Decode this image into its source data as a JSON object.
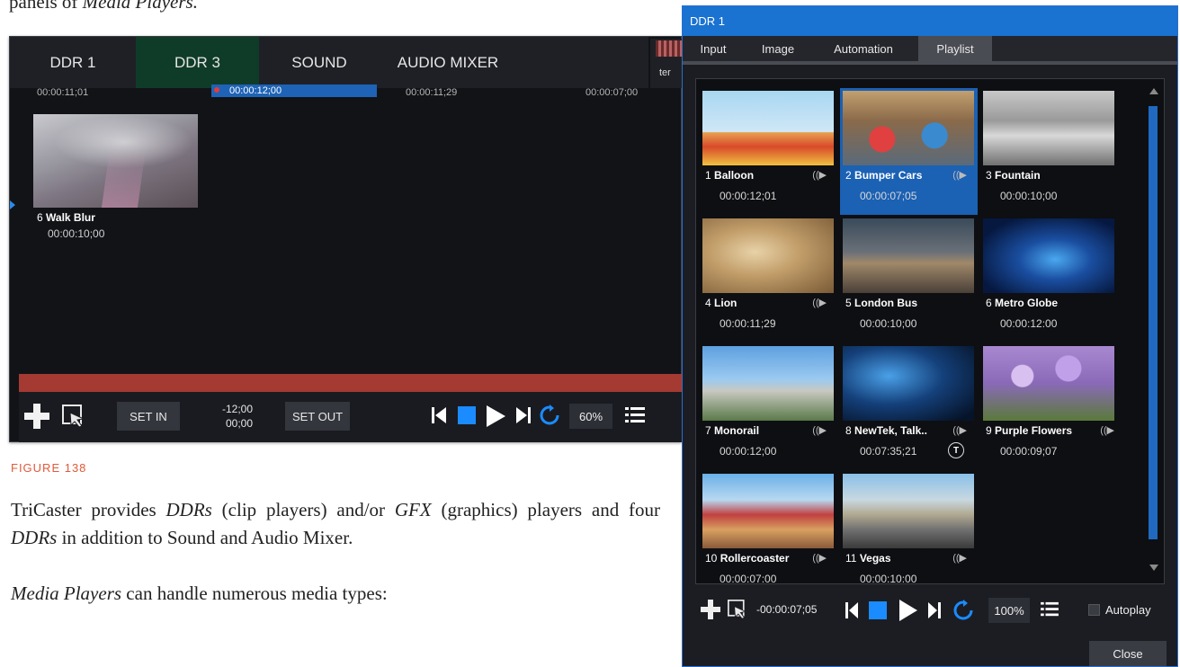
{
  "doc": {
    "top_text_prefix": "panels of ",
    "top_text_italic": "Media Players.",
    "figure_caption": "FIGURE 138",
    "para1_a": "TriCaster provides ",
    "para1_ddrs": "DDRs",
    "para1_b": " (clip players) and/or ",
    "para1_gfx": "GFX",
    "para1_c": " (graphics) players and four ",
    "para1_ddrs2": "DDRs",
    "para1_d": " in addition to Sound and Audio Mixer.",
    "para2_italic": "Media Players",
    "para2_rest": " can handle numerous media types:"
  },
  "left_panel": {
    "tabs": [
      "DDR 1",
      "DDR 3",
      "SOUND",
      "AUDIO MIXER"
    ],
    "corner_label": "ter",
    "times_row": [
      "00:00:11;01",
      "00:00:12;00",
      "00:00:11;29",
      "00:00:07;00"
    ],
    "clip": {
      "number": "6",
      "name": "Walk Blur",
      "duration": "00:00:10;00"
    },
    "controls": {
      "set_in": "SET IN",
      "set_out": "SET OUT",
      "dur_top": "-12;00",
      "dur_bottom": "00;00",
      "speed": "60%"
    }
  },
  "dialog": {
    "title": "DDR 1",
    "tabs": [
      "Input",
      "Image",
      "Automation",
      "Playlist"
    ],
    "active_tab": "Playlist",
    "items": [
      {
        "num": "1",
        "name": "Balloon",
        "time": "00:00:12;01",
        "audio": true
      },
      {
        "num": "2",
        "name": "Bumper Cars",
        "time": "00:00:07;05",
        "audio": true,
        "selected": true
      },
      {
        "num": "3",
        "name": "Fountain",
        "time": "00:00:10;00",
        "audio": false
      },
      {
        "num": "4",
        "name": "Lion",
        "time": "00:00:11;29",
        "audio": true
      },
      {
        "num": "5",
        "name": "London Bus",
        "time": "00:00:10;00",
        "audio": false
      },
      {
        "num": "6",
        "name": "Metro Globe",
        "time": "00:00:12:00",
        "audio": false
      },
      {
        "num": "7",
        "name": "Monorail",
        "time": "00:00:12;00",
        "audio": true
      },
      {
        "num": "8",
        "name": "NewTek, Talk..",
        "time": "00:07:35;21",
        "audio": true,
        "badge": "T"
      },
      {
        "num": "9",
        "name": "Purple Flowers",
        "time": "00:00:09;07",
        "audio": true
      },
      {
        "num": "10",
        "name": "Rollercoaster",
        "time": "00:00:07:00",
        "audio": true
      },
      {
        "num": "11",
        "name": "Vegas",
        "time": "00:00:10:00",
        "audio": true
      }
    ],
    "controls": {
      "duration": "-00:00:07;05",
      "speed": "100%",
      "autoplay": "Autoplay"
    },
    "close": "Close"
  }
}
